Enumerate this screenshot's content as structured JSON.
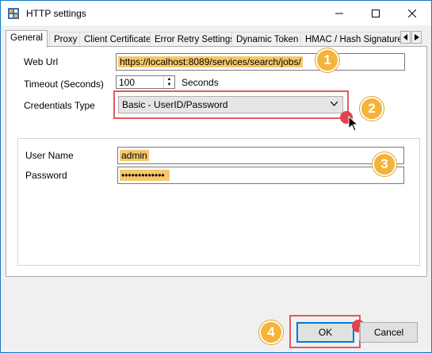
{
  "window": {
    "title": "HTTP settings",
    "icons": [
      "app-icon",
      "minimize-icon",
      "maximize-icon",
      "close-icon"
    ]
  },
  "tabs": [
    {
      "label": "General",
      "active": true
    },
    {
      "label": "Proxy",
      "active": false
    },
    {
      "label": "Client Certificate",
      "active": false
    },
    {
      "label": "Error Retry Settings",
      "active": false
    },
    {
      "label": "Dynamic Token",
      "active": false
    },
    {
      "label": "HMAC / Hash Signature",
      "active": false
    }
  ],
  "form": {
    "web_url_label": "Web Url",
    "web_url_value": "https://localhost:8089/services/search/jobs/",
    "timeout_label": "Timeout (Seconds)",
    "timeout_value": "100",
    "timeout_unit": "Seconds",
    "credentials_label": "Credentials Type",
    "credentials_value": "Basic - UserID/Password",
    "username_label": "User Name",
    "username_value": "admin",
    "password_label": "Password",
    "password_value": "•••••••••••••"
  },
  "steps": [
    "1",
    "2",
    "3",
    "4"
  ],
  "buttons": {
    "ok": "OK",
    "cancel": "Cancel"
  },
  "colors": {
    "highlight": "#f7c86a",
    "step_badge": "#f5b339",
    "focus_frame": "#e35a5a",
    "cursor_dot": "#e0434b"
  }
}
